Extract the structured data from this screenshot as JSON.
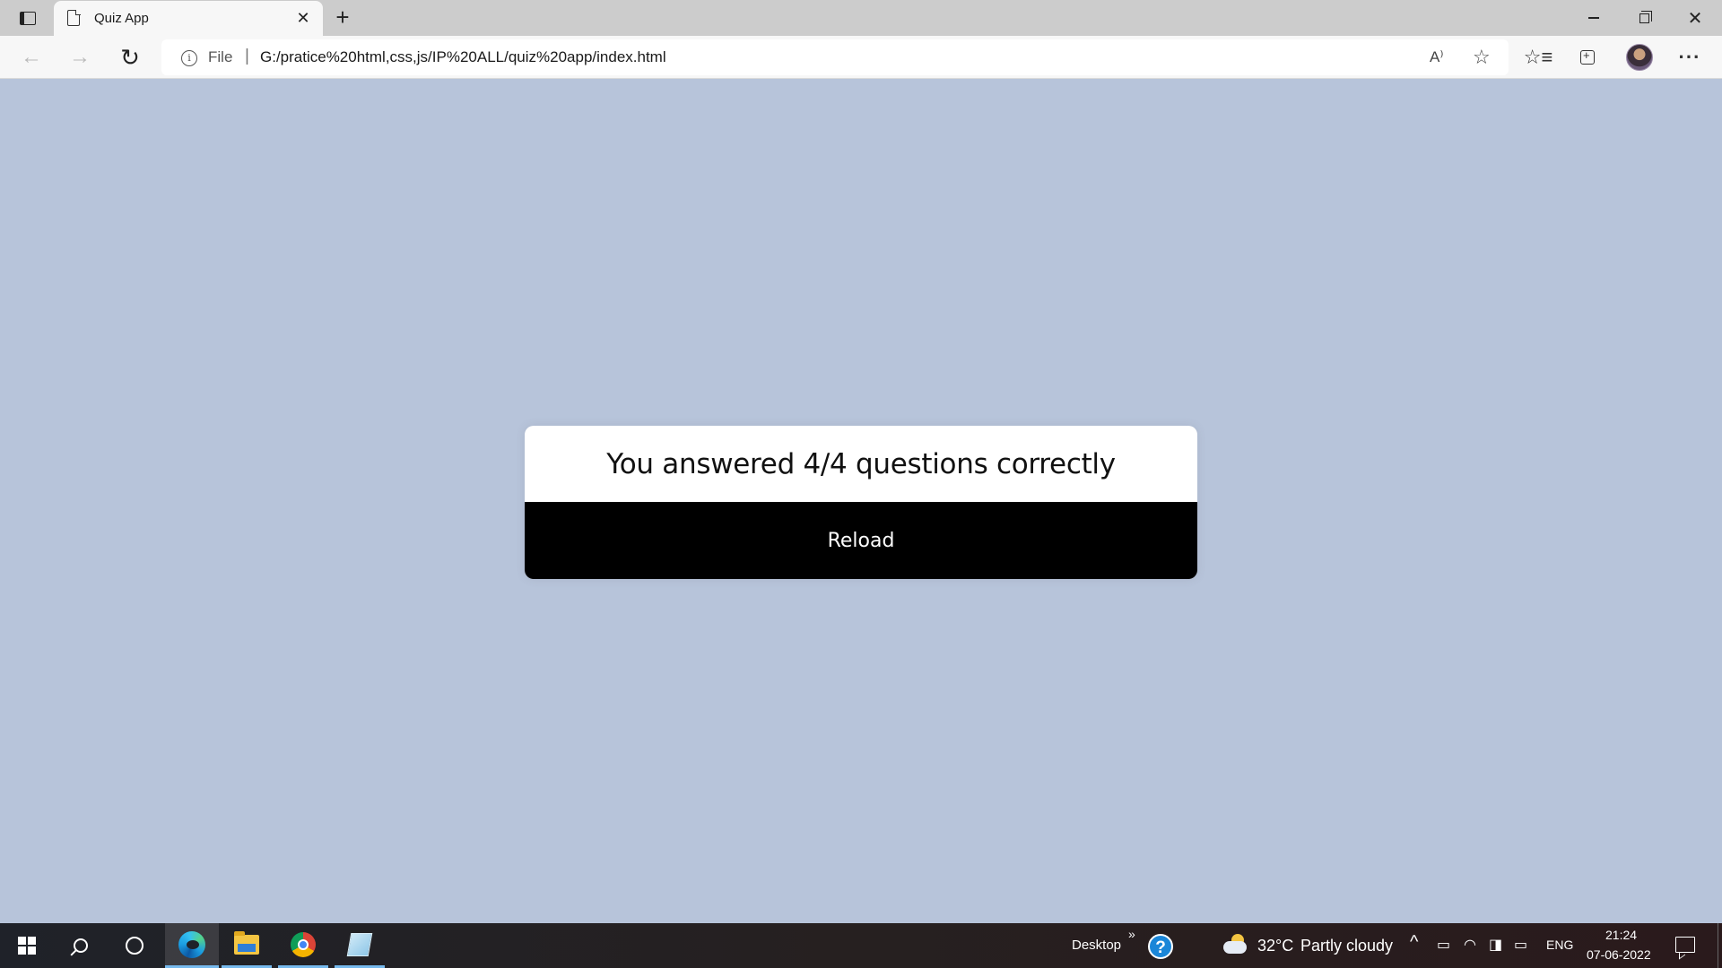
{
  "browser": {
    "tab": {
      "title": "Quiz App",
      "close_glyph": "✕"
    },
    "new_tab_glyph": "+",
    "window_controls": {
      "close_glyph": "✕"
    },
    "nav": {
      "back_glyph": "←",
      "forward_glyph": "→",
      "reload_glyph": "↻"
    },
    "address": {
      "info_glyph": "i",
      "scheme_label": "File",
      "separator": "|",
      "url": "G:/pratice%20html,css,js/IP%20ALL/quiz%20app/index.html",
      "read_aloud_glyph": "A⁾",
      "add_favorite_glyph": "☆"
    },
    "toolbar": {
      "favorites_glyph": "☆≡",
      "more_glyph": "···"
    }
  },
  "page": {
    "result_text": "You answered 4/4 questions correctly",
    "reload_label": "Reload"
  },
  "taskbar": {
    "desktop_label": "Desktop",
    "desktop_chevron": "»",
    "help_glyph": "?",
    "temperature": "32°C",
    "weather": "Partly cloudy",
    "tray_chevron": "^",
    "language": "ENG",
    "time": "21:24",
    "date": "07-06-2022"
  },
  "colors": {
    "page_background": "#b7c4da",
    "card_background": "#ffffff",
    "button_background": "#000000",
    "button_text": "#ffffff"
  },
  "icons": [
    "tab-actions-icon",
    "document-icon",
    "close-icon",
    "plus-icon",
    "minimize-icon",
    "restore-icon",
    "back-arrow-icon",
    "forward-arrow-icon",
    "reload-icon",
    "info-icon",
    "read-aloud-icon",
    "add-favorite-icon",
    "favorites-icon",
    "collections-icon",
    "avatar",
    "more-icon",
    "windows-logo-icon",
    "search-icon",
    "cortana-icon",
    "edge-icon",
    "file-explorer-icon",
    "chrome-icon",
    "notepad-icon",
    "help-icon",
    "weather-icon",
    "notification-icon"
  ]
}
